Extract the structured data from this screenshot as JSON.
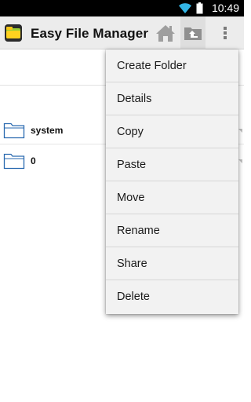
{
  "status_bar": {
    "time": "10:49"
  },
  "action_bar": {
    "title": "Easy File Manager"
  },
  "files": [
    {
      "name": "system"
    },
    {
      "name": "0"
    }
  ],
  "menu": {
    "items": [
      {
        "label": "Create Folder"
      },
      {
        "label": "Details"
      },
      {
        "label": "Copy"
      },
      {
        "label": "Paste"
      },
      {
        "label": "Move"
      },
      {
        "label": "Rename"
      },
      {
        "label": "Share"
      },
      {
        "label": "Delete"
      }
    ]
  },
  "colors": {
    "status_bar_bg": "#000000",
    "action_bar_bg": "#ececec",
    "folder_blue": "#2a6ab0",
    "menu_bg": "#f2f2f2"
  },
  "icons": [
    "wifi-icon",
    "battery-icon",
    "app-logo-icon",
    "home-icon",
    "folder-up-icon",
    "overflow-menu-icon",
    "folder-icon"
  ]
}
